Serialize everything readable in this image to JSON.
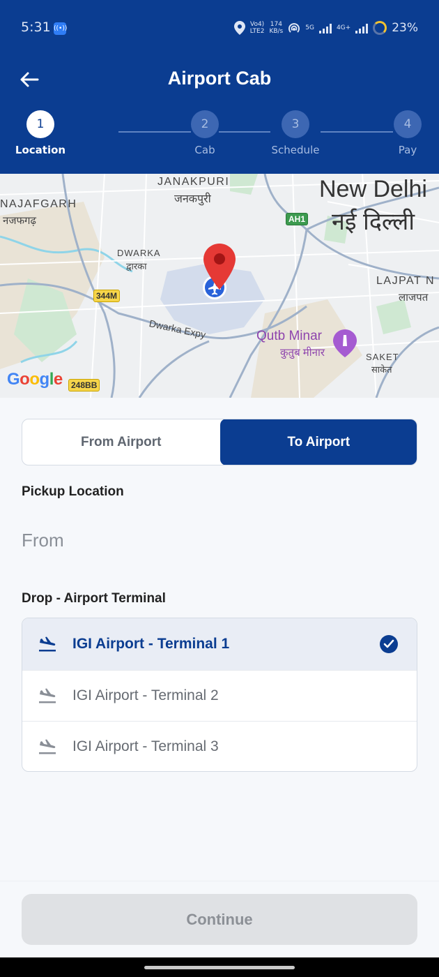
{
  "status_bar": {
    "time": "5:31",
    "network_top": "Vo4)",
    "network_bottom": "LTE2",
    "speed_value": "174",
    "speed_unit": "KB/s",
    "net_5g": "5G",
    "net_4g": "4G+",
    "battery": "23%"
  },
  "header": {
    "title": "Airport Cab"
  },
  "stepper": {
    "steps": [
      {
        "number": "1",
        "label": "Location"
      },
      {
        "number": "2",
        "label": "Cab"
      },
      {
        "number": "3",
        "label": "Schedule"
      },
      {
        "number": "4",
        "label": "Pay"
      }
    ]
  },
  "map": {
    "labels": {
      "janakpuri": "JANAKPURI",
      "janakpuri_hi": "जनकपुरी",
      "new_delhi": "New Delhi",
      "new_delhi_hi": "नई दिल्ली",
      "najafgarh": "NAJAFGARH",
      "najafgarh_hi": "नजफगढ़",
      "dwarka": "DWARKA",
      "dwarka_hi": "द्वारका",
      "lajpat": "LAJPAT N",
      "lajpat_hi": "लाजपत",
      "dwarka_expy": "Dwarka Expy",
      "qutb_minar": "Qutb Minar",
      "qutb_minar_hi": "कुतुब मीनार",
      "saket": "SAKET",
      "saket_hi": "साकेत"
    },
    "shields": {
      "ah1": "AH1",
      "r344m": "344M",
      "r248bb": "248BB"
    },
    "google": "Google"
  },
  "trip_toggle": {
    "from_airport": "From Airport",
    "to_airport": "To Airport"
  },
  "pickup": {
    "label": "Pickup Location",
    "placeholder": "From"
  },
  "drop": {
    "label": "Drop - Airport Terminal",
    "terminals": [
      "IGI Airport - Terminal 1",
      "IGI Airport - Terminal 2",
      "IGI Airport - Terminal 3"
    ]
  },
  "continue_label": "Continue",
  "colors": {
    "brand": "#0b3d91",
    "pin": "#e53935"
  }
}
